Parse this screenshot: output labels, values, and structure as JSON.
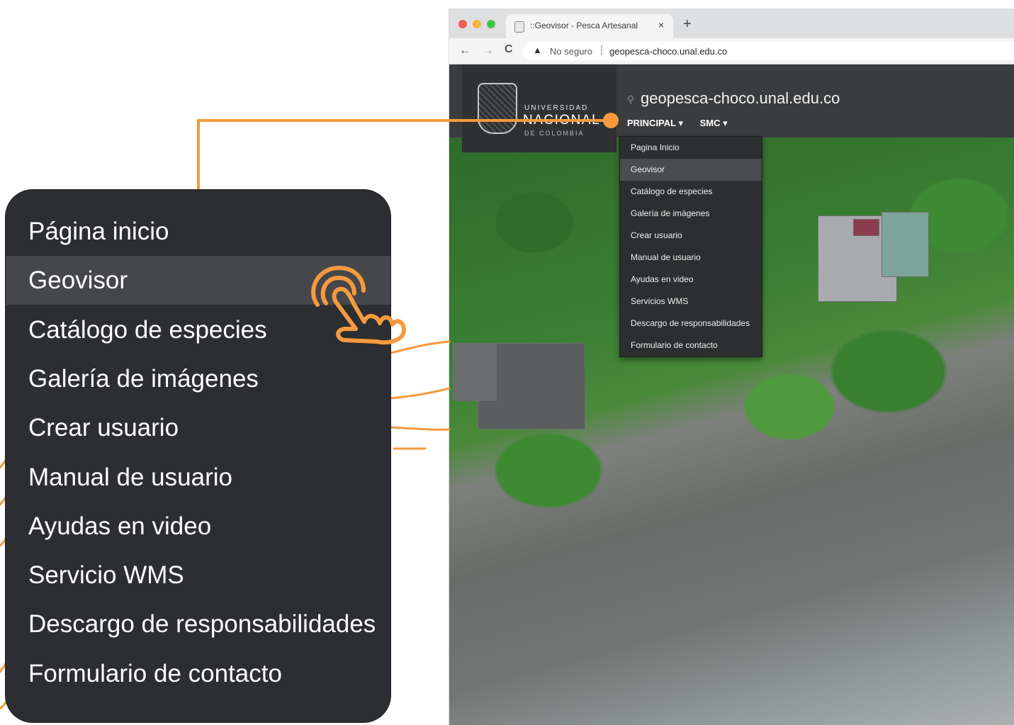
{
  "colors": {
    "accent": "#f59a3e",
    "menu_bg": "#2c2e31",
    "menu_active": "#45474b"
  },
  "browser": {
    "tab_title": "::Geovisor - Pesca Artesanal",
    "tab_close": "×",
    "new_tab": "+",
    "nav": {
      "back": "←",
      "forward": "→",
      "reload": "C"
    },
    "security_icon": "warning-triangle-icon",
    "security_label": "No seguro",
    "separator": "|",
    "url": "geopesca-choco.unal.edu.co"
  },
  "site": {
    "university_line1": "UNIVERSIDAD",
    "university_line2": "NACIONAL",
    "university_line3": "DE COLOMBIA",
    "domain_title": "geopesca-choco.unal.edu.co",
    "nav": {
      "principal": "PRINCIPAL ▾",
      "smc": "SMC ▾"
    },
    "dropdown_items": [
      "Pagina Inicio",
      "Geovisor",
      "Catálogo de especies",
      "Galería de imágenes",
      "Crear usuario",
      "Manual de usuario",
      "Ayudas en video",
      "Servicios WMS",
      "Descargo de responsabilidades",
      "Formulario de contacto"
    ],
    "active_index": 1
  },
  "zoom_menu": {
    "items": [
      "Página inicio",
      "Geovisor",
      "Catálogo de especies",
      "Galería de imágenes",
      "Crear usuario",
      "Manual de usuario",
      "Ayudas en video",
      "Servicio WMS",
      "Descargo de responsabilidades",
      "Formulario de contacto"
    ],
    "active_index": 1,
    "pointer_icon": "tap-hand-icon"
  }
}
